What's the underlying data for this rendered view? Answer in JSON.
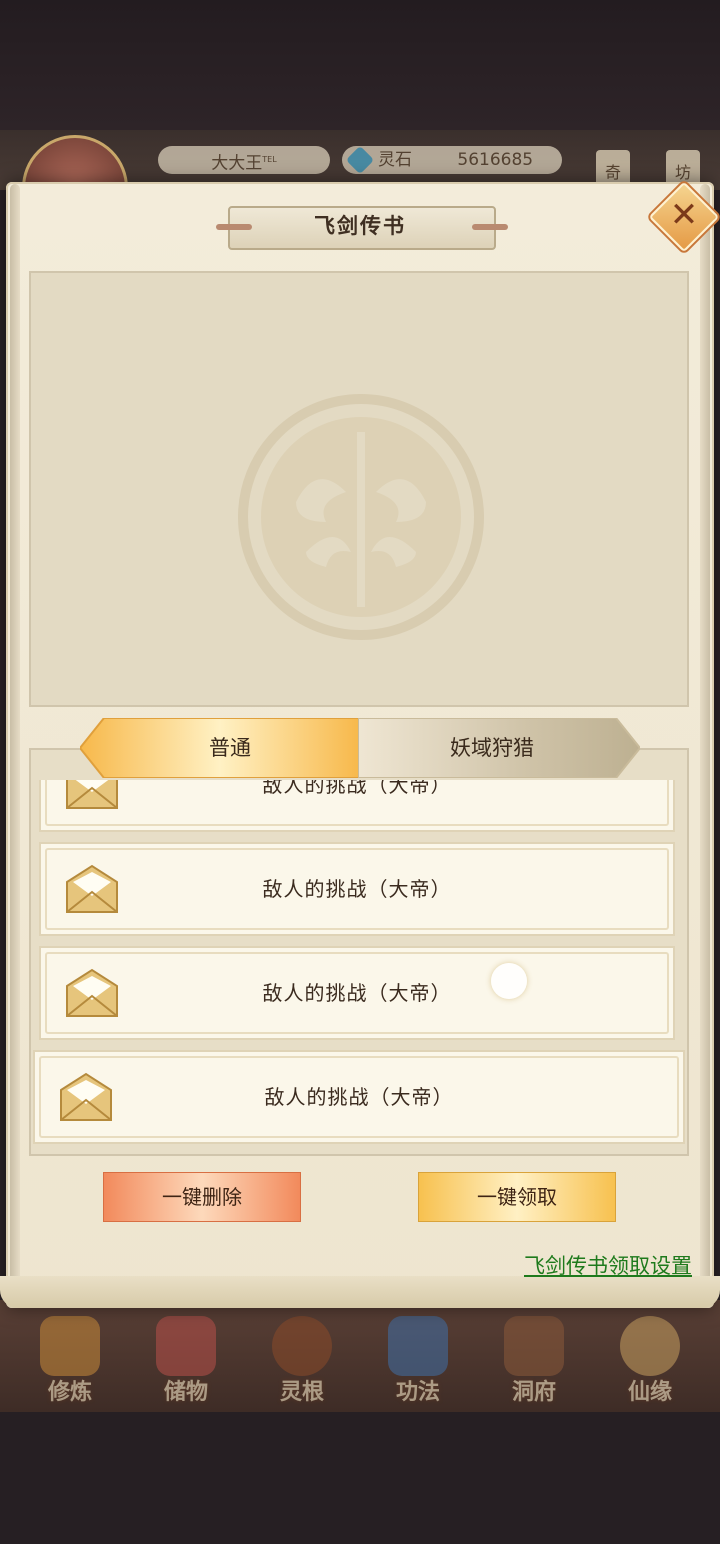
{
  "hud": {
    "player_name": "大大王",
    "player_name_suffix": "TEL",
    "currency_label": "灵石",
    "currency_value": "5616685",
    "side_tabs": [
      "奇",
      "坊"
    ]
  },
  "modal": {
    "title": "飞剑传书",
    "close_icon": "close-icon"
  },
  "tabs": [
    {
      "label": "普通",
      "active": true
    },
    {
      "label": "妖域狩猎",
      "active": false
    }
  ],
  "mail_items": [
    {
      "title": "敌人的挑战（大帝）",
      "icon": "envelope-icon"
    },
    {
      "title": "敌人的挑战（大帝）",
      "icon": "envelope-icon"
    },
    {
      "title": "敌人的挑战（大帝）",
      "icon": "envelope-icon"
    },
    {
      "title": "敌人的挑战（大帝）",
      "icon": "envelope-icon"
    }
  ],
  "actions": {
    "delete_all": "一键删除",
    "claim_all": "一键领取",
    "settings_link": "飞剑传书领取设置"
  },
  "nav": {
    "items": [
      {
        "label": "修炼",
        "icon": "meditating-figure-icon"
      },
      {
        "label": "储物",
        "icon": "pouch-icon"
      },
      {
        "label": "灵根",
        "icon": "spirit-root-icon"
      },
      {
        "label": "功法",
        "icon": "scroll-book-icon"
      },
      {
        "label": "洞府",
        "icon": "cave-house-icon"
      },
      {
        "label": "仙缘",
        "icon": "gourd-icon"
      }
    ]
  },
  "colors": {
    "parchment": "#f3ecda",
    "active_tab": "#f7c14f",
    "delete_button": "#f28a5c",
    "claim_button": "#f7c14f",
    "link": "#1e7a1c"
  }
}
